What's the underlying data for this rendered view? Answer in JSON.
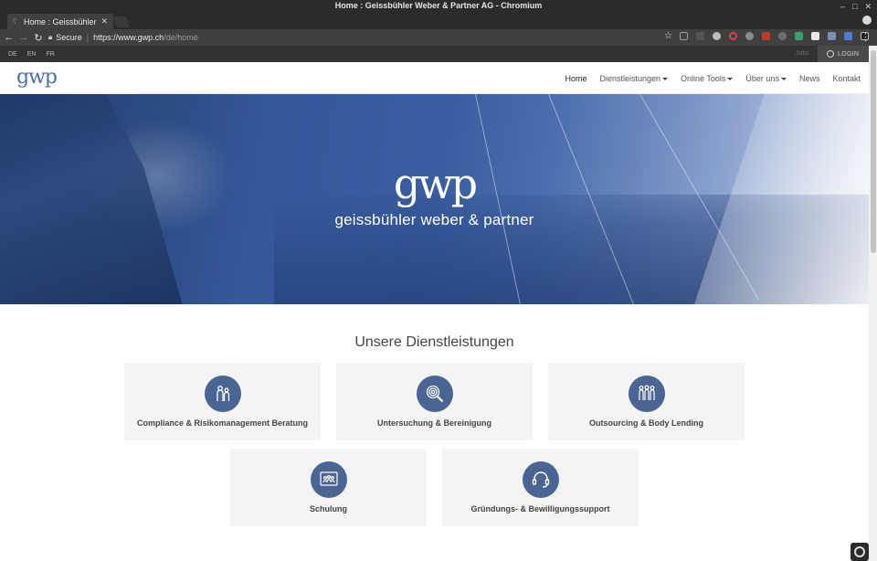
{
  "browser": {
    "window_title": "Home : Geissbühler Weber & Partner AG - Chromium",
    "tab_title": "Home : Geissbühler",
    "url_secure_label": "Secure",
    "url_host": "https://www.gwp.ch",
    "url_path": "/de/home"
  },
  "topbar": {
    "languages": [
      "DE",
      "EN",
      "FR"
    ],
    "jobs_label": "Jobs",
    "login_label": "LOGIN"
  },
  "nav": {
    "logo": "gwp",
    "items": [
      {
        "label": "Home",
        "dropdown": false,
        "active": true
      },
      {
        "label": "Dienstleistungen",
        "dropdown": true,
        "active": false
      },
      {
        "label": "Online Tools",
        "dropdown": true,
        "active": false
      },
      {
        "label": "Über uns",
        "dropdown": true,
        "active": false
      },
      {
        "label": "News",
        "dropdown": false,
        "active": false
      },
      {
        "label": "Kontakt",
        "dropdown": false,
        "active": false
      }
    ]
  },
  "hero": {
    "logo": "gwp",
    "tagline": "geissbühler weber & partner"
  },
  "services": {
    "title": "Unsere Dienstleistungen",
    "cards": [
      {
        "label": "Compliance & Risikomanagement Beratung",
        "icon": "people-icon"
      },
      {
        "label": "Untersuchung & Bereinigung",
        "icon": "magnifier-icon"
      },
      {
        "label": "Outsourcing & Body Lending",
        "icon": "group-icon"
      },
      {
        "label": "Schulung",
        "icon": "presentation-icon"
      },
      {
        "label": "Gründungs- & Bewilligungssupport",
        "icon": "headset-icon"
      }
    ]
  },
  "colors": {
    "brand": "#4b6fa3",
    "icon_circle": "#4a6593",
    "card_bg": "#f4f4f4",
    "topbar_bg": "#323232"
  }
}
